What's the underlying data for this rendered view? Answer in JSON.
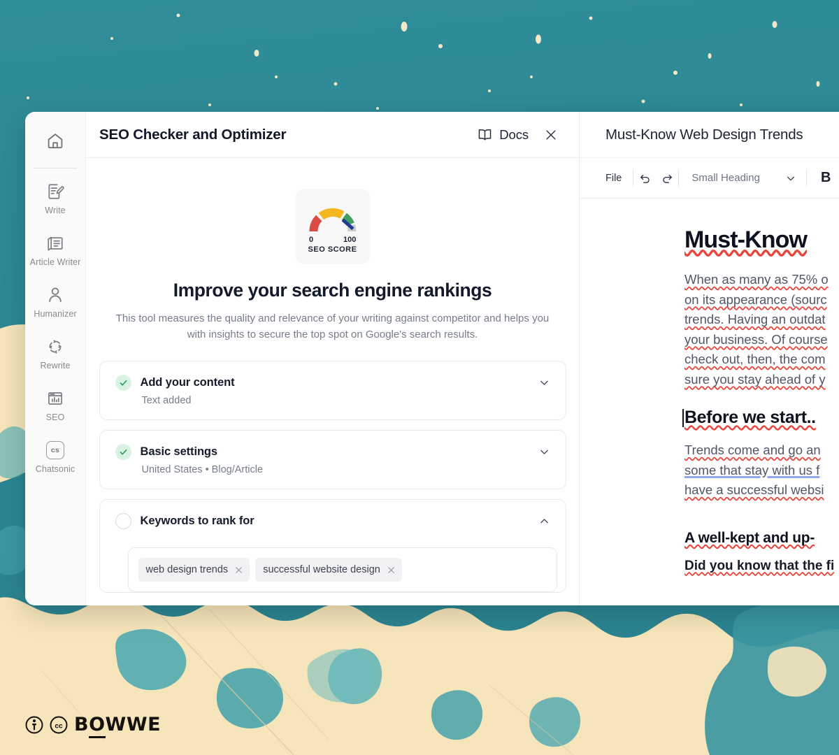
{
  "background": {
    "teal": "#2d8b96",
    "sand": "#f6e5ba"
  },
  "rail": {
    "home_icon": "home-icon",
    "items": [
      {
        "label": "Write",
        "icon": "document-pencil-icon"
      },
      {
        "label": "Article Writer",
        "icon": "article-icon"
      },
      {
        "label": "Humanizer",
        "icon": "person-icon"
      },
      {
        "label": "Rewrite",
        "icon": "refresh-cycle-icon"
      },
      {
        "label": "SEO",
        "icon": "chart-window-icon"
      },
      {
        "label": "Chatsonic",
        "icon": "cs-badge-icon",
        "badge": "cs"
      }
    ]
  },
  "seo_panel": {
    "title": "SEO Checker and Optimizer",
    "docs_label": "Docs",
    "docs_icon": "book-icon",
    "close_icon": "close-icon",
    "gauge": {
      "min_label": "0",
      "max_label": "100",
      "caption": "SEO SCORE",
      "segments": [
        {
          "name": "low",
          "color": "#d94b45"
        },
        {
          "name": "medium",
          "color": "#f5b720"
        },
        {
          "name": "high",
          "color": "#42a05f"
        },
        {
          "name": "empty",
          "color": "#c9cbcd"
        }
      ],
      "needle_color": "#1f3a93"
    },
    "heading": "Improve your search engine rankings",
    "subheading_line1": "This tool measures the quality and relevance of your writing against competitor",
    "subheading_line2": "and helps you with insights to secure the top spot on Google's search results.",
    "accordions": [
      {
        "title": "Add your content",
        "subtitle": "Text added",
        "state": "complete",
        "chevron": "chevron-down-icon"
      },
      {
        "title": "Basic settings",
        "subtitle": "United States • Blog/Article",
        "state": "complete",
        "chevron": "chevron-down-icon"
      },
      {
        "title": "Keywords to rank for",
        "subtitle": "",
        "state": "incomplete",
        "chevron": "chevron-up-icon"
      }
    ],
    "keywords": [
      "web design trends",
      "successful website design"
    ]
  },
  "doc_panel": {
    "title": "Must-Know Web Design Trends",
    "toolbar": {
      "file_label": "File",
      "undo_icon": "undo-icon",
      "redo_icon": "redo-icon",
      "style_value": "Small Heading",
      "style_chevron": "chevron-down-icon",
      "bold_label": "B"
    },
    "content": {
      "h1": "Must-Know ",
      "p1": [
        "When as many as 75% o",
        "on its appearance (sourc",
        "trends. Having an outdat",
        "your business. Of course",
        "check out, then, the com",
        "sure you stay ahead of y"
      ],
      "h2": "Before we start..",
      "p2": [
        "Trends come and go an",
        "some that stay with us f",
        "have a successful websi"
      ],
      "h3": "A well-kept and up-",
      "p3": "Did you know that the fi"
    }
  },
  "logo": {
    "accessibility_icon": "accessibility-icon",
    "cc_icon": "creative-commons-icon",
    "brand_part1": "B",
    "brand_part2": "O",
    "brand_part3": "WWE"
  }
}
